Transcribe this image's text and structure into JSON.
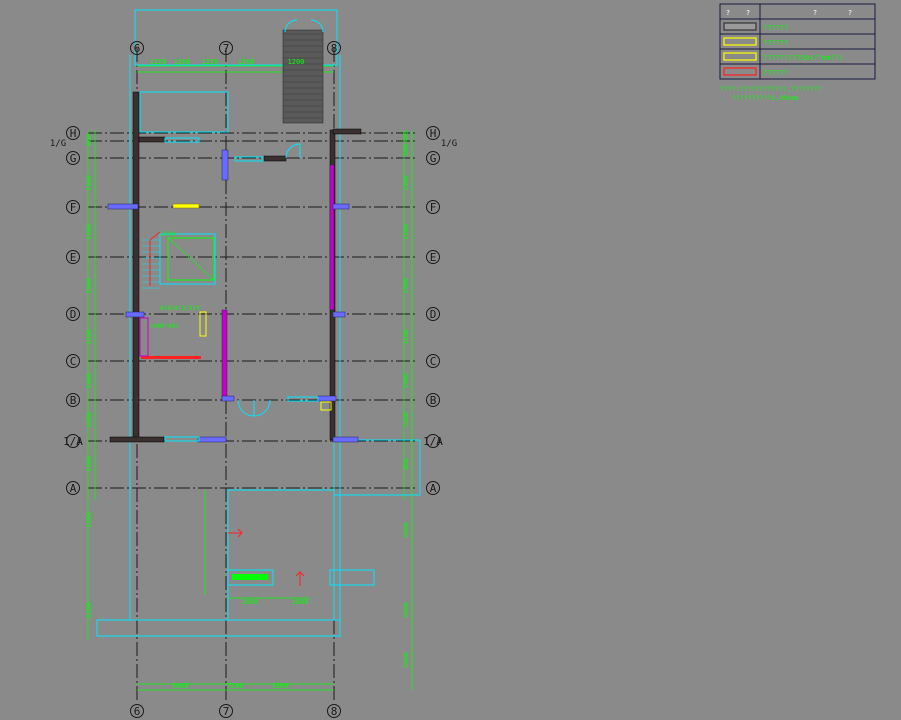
{
  "colors": {
    "background": "#8a8a8a",
    "axis": "#1a1a1a",
    "dim": "#00ff00",
    "frame": "#00e5ff",
    "wall": "#3a3030",
    "partition": "#c800c8",
    "legend_red": "#ff2020",
    "legend_yellow": "#ffff00",
    "bubble": "#00ff00",
    "legend_grid": "#1a1a40"
  },
  "grid": {
    "row_labels": [
      "H",
      "G",
      "F",
      "E",
      "D",
      "C",
      "B",
      "1/A",
      "A"
    ],
    "extra_row_label": "1/G",
    "col_labels": [
      "6",
      "7",
      "8"
    ]
  },
  "dimensions": {
    "top": [
      "1220",
      "1300",
      "1220",
      "1200",
      "1200"
    ],
    "bottom": [
      "3400",
      "7200",
      "3800"
    ],
    "left": [
      "800",
      "1500",
      "1500",
      "1500",
      "1500",
      "1500",
      "1500",
      "1500",
      "1500",
      "2300"
    ],
    "right": [
      "400",
      "800",
      "1500",
      "1500",
      "1500",
      "1500",
      "1500",
      "1200",
      "800",
      "2000",
      "2000",
      "2000"
    ],
    "site": [
      "1800",
      "1800"
    ]
  },
  "room_labels": {
    "stair": "LG04",
    "stair_ref": "8(8)4(3/3)3",
    "kitchen": "1000(40)"
  },
  "legend": {
    "header": [
      "?",
      "?",
      "?",
      "?"
    ],
    "rows": [
      {
        "swatch": "hatch",
        "label": "??????"
      },
      {
        "swatch": "yellow",
        "label": "??????"
      },
      {
        "swatch": "yellow-outline",
        "label": "??????(??50×??mm??)"
      },
      {
        "swatch": "red",
        "label": "??????"
      }
    ],
    "note1": "????:????????????,????????",
    "note2": "??????????2,300mm"
  }
}
